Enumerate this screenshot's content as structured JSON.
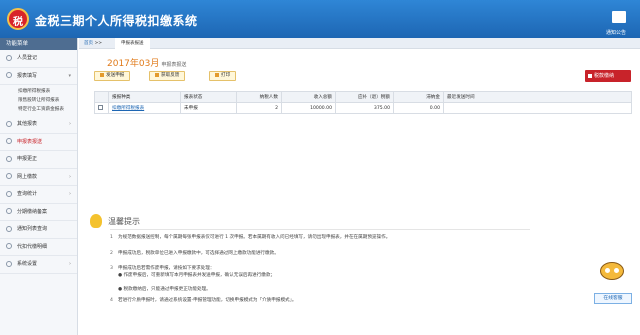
{
  "header": {
    "logo_char": "税",
    "title": "金税三期个人所得税扣缴系统",
    "notice_label": "通知公告"
  },
  "sidebar": {
    "head": "功能菜单",
    "items": [
      {
        "label": "人员登记",
        "arrow": ""
      },
      {
        "label": "报表填写",
        "arrow": "▾"
      }
    ],
    "subitems": [
      "扣缴所得税报表",
      "限售股转让所得报表",
      "特定行业工资薪金报表"
    ],
    "items2": [
      {
        "label": "其他报表",
        "arrow": "›"
      },
      {
        "label": "申报表报送",
        "arrow": ""
      },
      {
        "label": "申报更正",
        "arrow": ""
      },
      {
        "label": "网上缴款",
        "arrow": "›"
      },
      {
        "label": "查询统计",
        "arrow": "›"
      },
      {
        "label": "分期缴纳备案",
        "arrow": ""
      },
      {
        "label": "通知列表查询",
        "arrow": ""
      },
      {
        "label": "代扣代缴明细",
        "arrow": ""
      },
      {
        "label": "系统设置",
        "arrow": "›"
      }
    ]
  },
  "crumb": {
    "home": "首页",
    "sep": ">>",
    "tab": "申报表报送"
  },
  "period": {
    "text": "2017年03月",
    "sub": "申报表报送"
  },
  "toolbar": {
    "btn1": "发送申报",
    "btn2": "获取反馈",
    "btn3": "打印"
  },
  "red_button": "税款缴纳",
  "table": {
    "headers": [
      "",
      "报报种类",
      "报表状态",
      "纳税人数",
      "收入总额",
      "应补（退）税额",
      "滞纳金",
      "最近发送时间"
    ],
    "rows": [
      [
        "",
        "扣缴所得税报表",
        "未申报",
        "2",
        "10000.00",
        "375.00",
        "0.00",
        ""
      ]
    ]
  },
  "tips": {
    "title": "温馨提示",
    "lines": [
      {
        "n": "1",
        "text": "为规范数据报送控制，每个属期每张申报表仅可进行 1 次申报。若本属期有收入问已经填写，请勿出现申报表，并在在属期预览操作。"
      },
      {
        "n": "2",
        "text": "申报成功后，税款单位已进入申报缴款中，可选择通过网上缴款功能进行缴款。"
      },
      {
        "n": "3",
        "text": "申报成功后若需作废申报，请按如下要求处理："
      },
      {
        "n": "",
        "text": "● 作废申报后，可重新填写本月申报表并发送申报，确认无误后再进行缴款；"
      },
      {
        "n": "",
        "text": "● 税款缴纳后，只能通过申报更正功能处理。"
      },
      {
        "n": "4",
        "text": "若进行介质申报时，请通过系统设置-申报管理功能，切换申报模式为「介质申报模式」。"
      }
    ]
  },
  "online_btn": "在线客服"
}
